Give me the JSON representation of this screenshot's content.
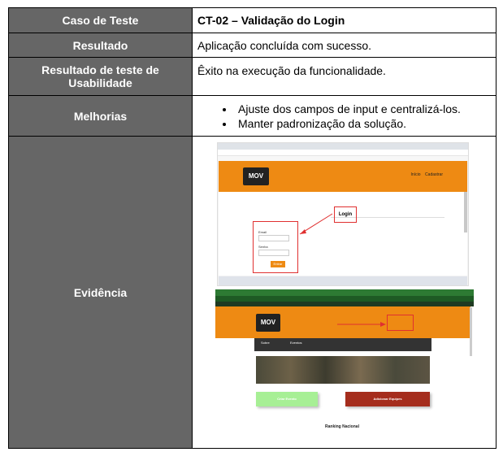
{
  "table": {
    "caso_label": "Caso de Teste",
    "caso_value": "CT-02 – Validação do Login",
    "resultado_label": "Resultado",
    "resultado_value": "Aplicação concluída com sucesso.",
    "usabilidade_label": "Resultado de teste de Usabilidade",
    "usabilidade_value": "Êxito na execução da funcionalidade.",
    "melhorias_label": "Melhorias",
    "melhorias": [
      "Ajuste dos campos de input e centralizá-los.",
      "Manter padronização da solução."
    ],
    "evidencia_label": "Evidência"
  },
  "evidence": {
    "shot1": {
      "logo_text": "MOV",
      "login_title": "Login",
      "email_label": "Email",
      "senha_label": "Senha",
      "button_label": "Entrar",
      "nav_items": [
        "Início",
        "Cadastrar"
      ]
    },
    "shot2": {
      "logo_text": "MOV",
      "darkbar_items": [
        "Sobre",
        "Eventos"
      ],
      "green_button": "Criar Evento",
      "red_button": "Adicionar Equipes",
      "ranking_label": "Ranking Nacional"
    }
  },
  "colors": {
    "label_bg": "#666666",
    "header_orange": "#ee8a13",
    "highlight_red": "#e03030"
  }
}
